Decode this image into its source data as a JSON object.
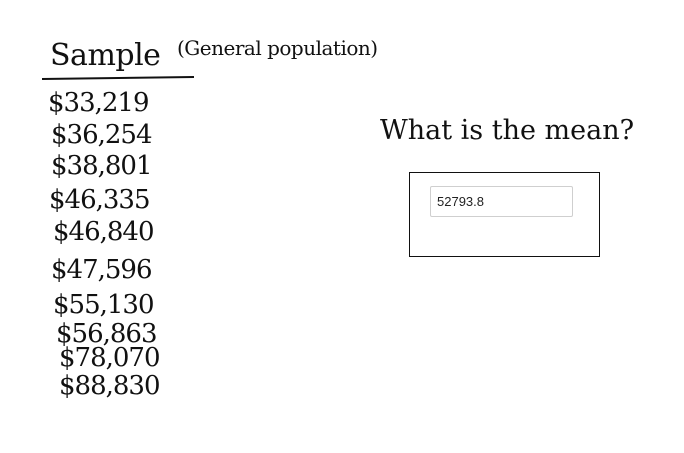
{
  "sample": {
    "heading": "Sample",
    "subheading": "(General population)",
    "values": [
      "$33,219",
      "$36,254",
      "$38,801",
      "$46,335",
      "$46,840",
      "$47,596",
      "$55,130",
      "$56,863",
      "$78,070",
      "$88,830"
    ]
  },
  "question": {
    "text": "What is the mean?",
    "answer_value": "52793.8"
  }
}
